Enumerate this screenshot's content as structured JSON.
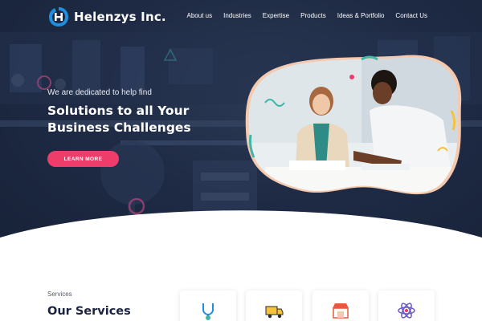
{
  "brand": {
    "name": "Helenzys Inc."
  },
  "nav": {
    "items": [
      {
        "label": "About us"
      },
      {
        "label": "Industries"
      },
      {
        "label": "Expertise"
      },
      {
        "label": "Products"
      },
      {
        "label": "Ideas & Portfolio"
      },
      {
        "label": "Contact Us"
      }
    ]
  },
  "hero": {
    "tagline": "We are dedicated to help find",
    "headline_line1": "Solutions to all Your",
    "headline_line2": "Business Challenges",
    "cta_label": "LEARN MORE"
  },
  "services": {
    "eyebrow": "Services",
    "title": "Our Services",
    "cards": [
      {
        "icon": "stethoscope-icon"
      },
      {
        "icon": "truck-icon"
      },
      {
        "icon": "storefront-icon"
      },
      {
        "icon": "atom-icon"
      }
    ]
  },
  "colors": {
    "hero_bg": "#1f2b45",
    "accent": "#ef3d6b",
    "brand_blue": "#1e8fe0",
    "heading_dark": "#1b2340"
  }
}
